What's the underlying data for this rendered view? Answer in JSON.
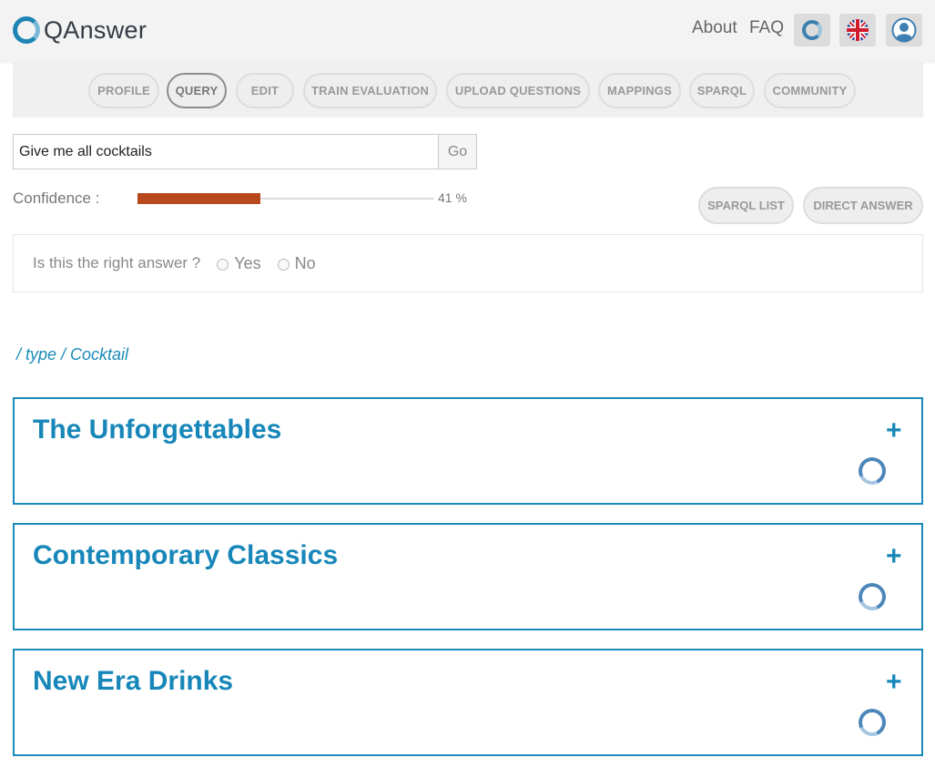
{
  "header": {
    "logo_text": "QAnswer",
    "nav": {
      "about": "About",
      "faq": "FAQ"
    },
    "icons": [
      "qanswer-logo-icon",
      "uk-flag-icon",
      "user-avatar-icon"
    ]
  },
  "tabs": [
    {
      "label": "PROFILE",
      "active": false
    },
    {
      "label": "QUERY",
      "active": true
    },
    {
      "label": "EDIT",
      "active": false
    },
    {
      "label": "TRAIN EVALUATION",
      "active": false
    },
    {
      "label": "UPLOAD QUESTIONS",
      "active": false
    },
    {
      "label": "MAPPINGS",
      "active": false
    },
    {
      "label": "SPARQL",
      "active": false
    },
    {
      "label": "COMMUNITY",
      "active": false
    }
  ],
  "query": {
    "value": "Give me all cocktails",
    "button": "Go"
  },
  "confidence": {
    "label": "Confidence :",
    "value": 0.41,
    "display": "41 %",
    "color": "#b9481c"
  },
  "actions": {
    "sparql_list": "SPARQL LIST",
    "direct_answer": "DIRECT ANSWER"
  },
  "feedback": {
    "question": "Is this the right answer ?",
    "yes": "Yes",
    "no": "No"
  },
  "breadcrumb": "/ type / Cocktail",
  "results": [
    {
      "title": "The Unforgettables"
    },
    {
      "title": "Contemporary Classics"
    },
    {
      "title": "New Era Drinks"
    }
  ],
  "colors": {
    "accent": "#1787b9",
    "header_bg": "#f3f3f3",
    "tab_bg": "#eeeeee"
  }
}
